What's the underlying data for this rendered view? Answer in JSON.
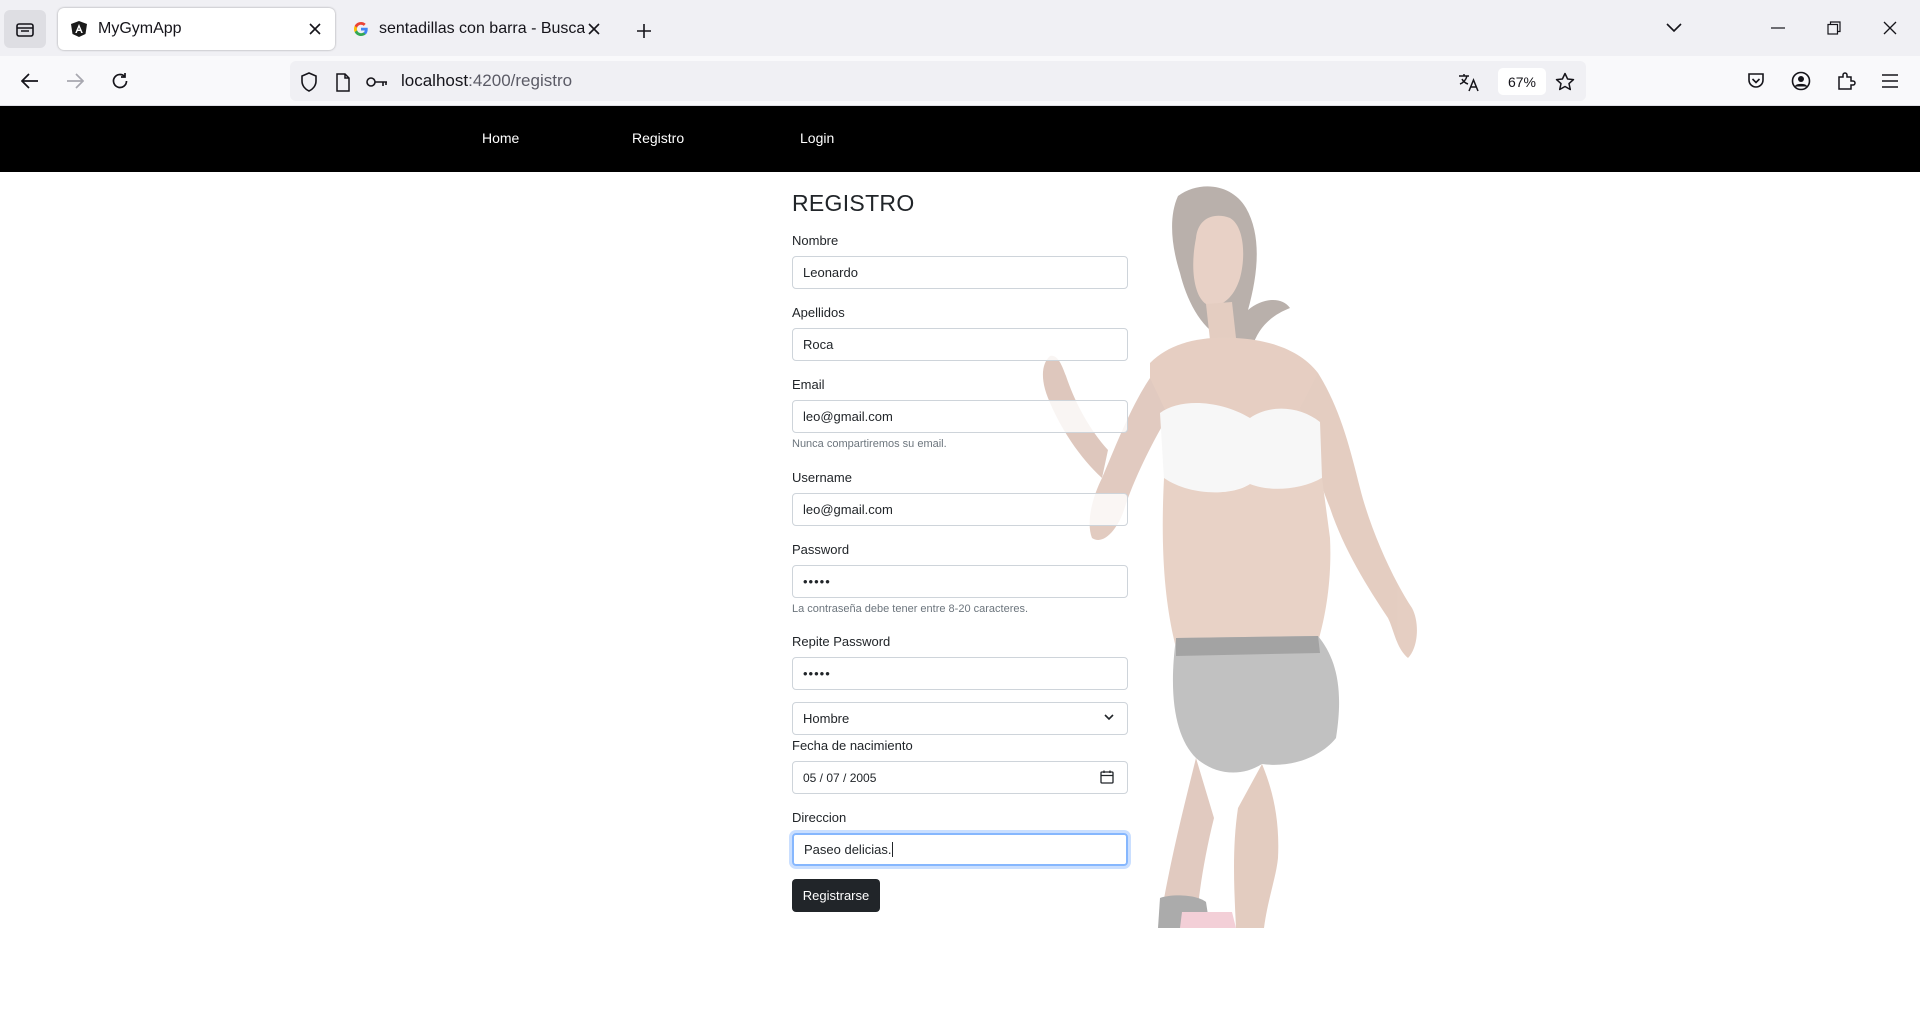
{
  "browser": {
    "tabs": [
      {
        "title": "MyGymApp",
        "active": true
      },
      {
        "title": "sentadillas con barra - Buscar con Google",
        "active": false
      }
    ],
    "url": {
      "host": "localhost",
      "path": ":4200/registro"
    },
    "zoom": "67%"
  },
  "app_nav": {
    "home": "Home",
    "registro": "Registro",
    "login": "Login"
  },
  "form": {
    "title": "REGISTRO",
    "nombre_label": "Nombre",
    "nombre_value": "Leonardo",
    "apellidos_label": "Apellidos",
    "apellidos_value": "Roca",
    "email_label": "Email",
    "email_value": "leo@gmail.com",
    "email_help": "Nunca compartiremos su email.",
    "username_label": "Username",
    "username_value": "leo@gmail.com",
    "password_label": "Password",
    "password_value": "•••••",
    "password_help": "La contraseña debe tener entre 8-20 caracteres.",
    "repite_label": "Repite Password",
    "repite_value": "•••••",
    "sexo_value": "Hombre",
    "fecha_label": "Fecha de nacimiento",
    "fecha_value": "05 / 07 / 2005",
    "direccion_label": "Direccion",
    "direccion_value": "Paseo delicias.",
    "submit_label": "Registrarse"
  }
}
